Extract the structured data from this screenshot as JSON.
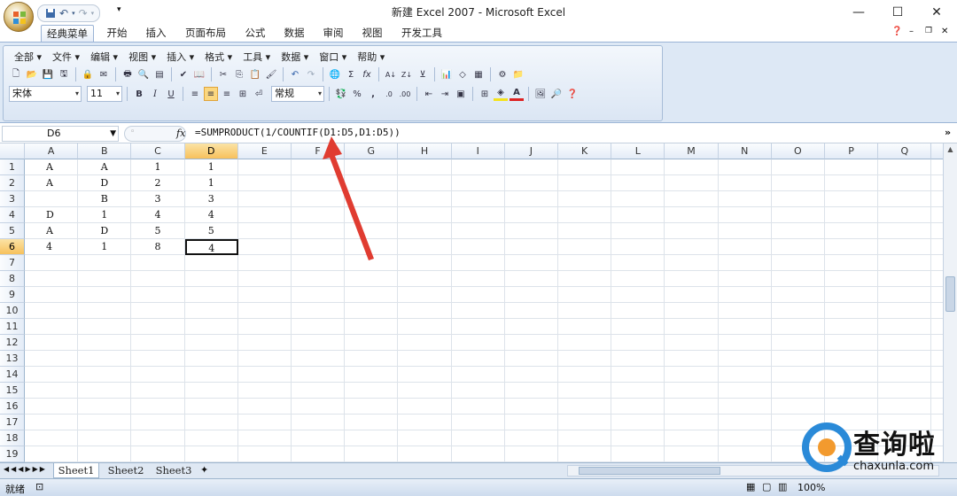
{
  "title": "新建 Excel 2007 - Microsoft Excel",
  "qat": {
    "save": "save-icon",
    "undo": "↶",
    "redo": "↷"
  },
  "window_buttons": {
    "minimize": "—",
    "maximize": "☐",
    "close": "✕"
  },
  "tabs": [
    "经典菜单",
    "开始",
    "插入",
    "页面布局",
    "公式",
    "数据",
    "审阅",
    "视图",
    "开发工具"
  ],
  "active_tab": "经典菜单",
  "menu": [
    "全部",
    "文件",
    "编辑",
    "视图",
    "插入",
    "格式",
    "工具",
    "数据",
    "窗口",
    "帮助"
  ],
  "toolbar": {
    "font": "宋体",
    "size": "11",
    "bold": "B",
    "italic": "I",
    "underline": "U",
    "number_format": "常规",
    "percent": "%",
    "comma": ",",
    "sum": "Σ",
    "fx": "fx",
    "sort_asc": "A↓",
    "sort_desc": "Z↓"
  },
  "formula_bar": {
    "name_box": "D6",
    "fx_label": "fx",
    "formula": "=SUMPRODUCT(1/COUNTIF(D1:D5,D1:D5))"
  },
  "columns": [
    "A",
    "B",
    "C",
    "D",
    "E",
    "F",
    "G",
    "H",
    "I",
    "J",
    "K",
    "L",
    "M",
    "N",
    "O",
    "P",
    "Q"
  ],
  "rows": [
    "1",
    "2",
    "3",
    "4",
    "5",
    "6",
    "7",
    "8",
    "9",
    "10",
    "11",
    "12",
    "13",
    "14",
    "15",
    "16",
    "17",
    "18",
    "19"
  ],
  "cells": [
    [
      "A",
      "A",
      "1",
      "1"
    ],
    [
      "A",
      "D",
      "2",
      "1"
    ],
    [
      "",
      "B",
      "3",
      "3"
    ],
    [
      "D",
      "1",
      "4",
      "4"
    ],
    [
      "A",
      "D",
      "5",
      "5"
    ],
    [
      "4",
      "1",
      "8",
      "4"
    ]
  ],
  "selected_cell": "D6",
  "sheets": [
    "Sheet1",
    "Sheet2",
    "Sheet3"
  ],
  "active_sheet": "Sheet1",
  "status": {
    "ready": "就绪",
    "zoom": "100%"
  },
  "watermark": {
    "brand": "查询啦",
    "url": "chaxunla.com"
  },
  "colors": {
    "accent": "#e03c31",
    "selection": "#f7c15c",
    "ribbon": "#dde8f5"
  }
}
